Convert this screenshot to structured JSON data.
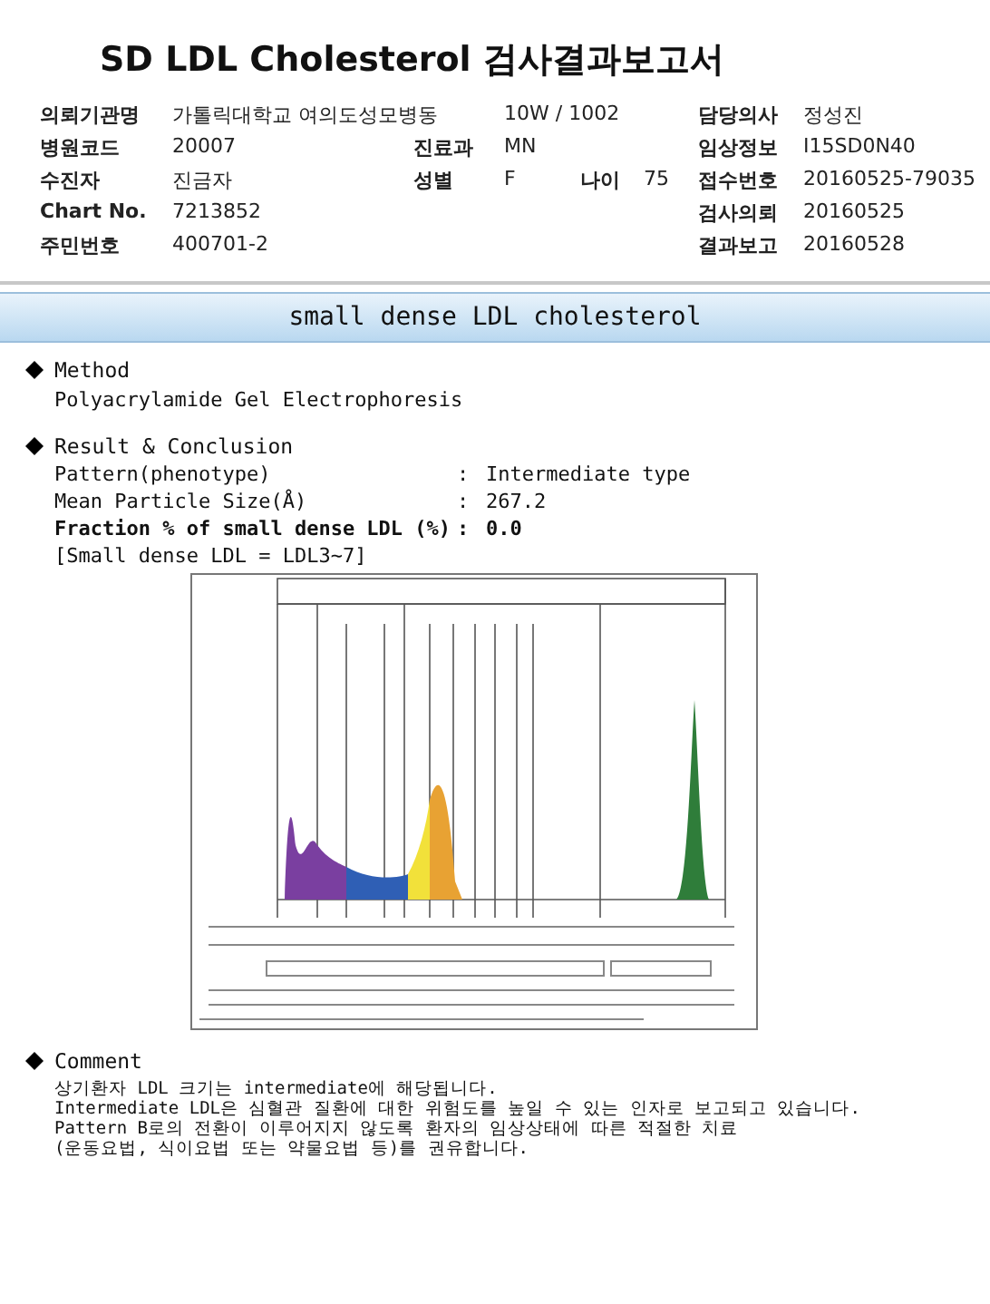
{
  "title": "SD LDL Cholesterol 검사결과보고서",
  "info_rows": [
    {
      "left": {
        "label": "의뢰기관명",
        "value": "가톨릭대학교 여의도성모병동"
      },
      "mid": {
        "value": "10W / 1002"
      },
      "right": {
        "label": "담당의사",
        "value": "정성진"
      }
    },
    {
      "left": {
        "label": "병원코드",
        "value": "20007"
      },
      "mid": {
        "label": "진료과",
        "value": "MN"
      },
      "right": {
        "label": "임상정보",
        "value": "I15SD0N40"
      }
    },
    {
      "left": {
        "label": "수진자",
        "value": "진금자"
      },
      "mid": {
        "label": "성별",
        "value": "F"
      },
      "age": {
        "label": "나이",
        "value": "75"
      },
      "right": {
        "label": "접수번호",
        "value": "20160525-79035"
      }
    },
    {
      "left": {
        "label": "Chart No.",
        "value": "7213852"
      },
      "right": {
        "label": "검사의뢰",
        "value": "20160525"
      }
    },
    {
      "left": {
        "label": "주민번호",
        "value": "400701-2"
      },
      "right": {
        "label": "결과보고",
        "value": "20160528"
      }
    }
  ],
  "band_title": "small dense LDL cholesterol",
  "method": {
    "heading": "Method",
    "text": "Polyacrylamide Gel Electrophoresis"
  },
  "result": {
    "heading": "Result & Conclusion",
    "items": [
      {
        "label": "Pattern(phenotype)",
        "separator": ":",
        "value": "Intermediate type",
        "bold": false
      },
      {
        "label": "Mean Particle Size(Å)",
        "separator": ":",
        "value": "267.2",
        "bold": false
      },
      {
        "label": "Fraction % of small dense LDL (%)",
        "separator": ":",
        "value": "0.0",
        "bold": true
      }
    ],
    "note": "[Small dense LDL = LDL3~7]"
  },
  "comment": {
    "heading": "Comment",
    "lines": [
      "상기환자 LDL 크기는 intermediate에 해당됩니다.",
      "Intermediate LDL은 심혈관 질환에 대한 위험도를 높일 수 있는 인자로 보고되고 있습니다.",
      "Pattern B로의 전환이 이루어지지 않도록 환자의 임상상태에 따른 적절한 치료",
      "(운동요법, 식이요법 또는 약물요법 등)를 권유합니다."
    ]
  }
}
